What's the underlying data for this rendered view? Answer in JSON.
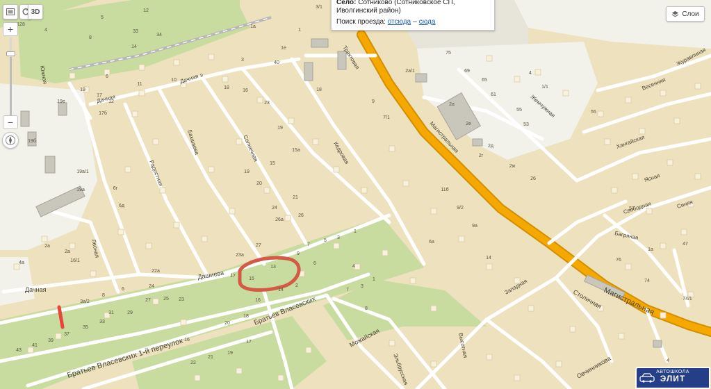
{
  "popup": {
    "title_bold": "Село:",
    "title_text": "Сотниково (Сотниковское СП, Иволгинский район)",
    "route_label": "Поиск проезда:",
    "route_from": "отсюда",
    "route_to": "сюда",
    "route_dash": "–"
  },
  "layers": {
    "label": "Слои",
    "icon": "layers-icon"
  },
  "controls": {
    "fullscreen_icon": "fullscreen-icon",
    "rotate_icon": "rotate-icon",
    "view_3d": "3D",
    "zoom_in": "+",
    "zoom_out": "−",
    "zoom_level": 0.82,
    "compass_icon": "compass-icon"
  },
  "streets": {
    "magistralnaya_1": "Магистральная",
    "magistralnaya_2": "Магистральная",
    "dachnaya_1": "Дачная",
    "dachnaya_2": "Дачная",
    "dachnaya_3": "Дачная",
    "dashieva": "Дашиева",
    "bratyev_vlasevskikh": "Братьев Власевских",
    "pereulok_1": "Братьев Власевских 1-й переулок",
    "mozhayskaya": "Можайская",
    "elbrusskaya": "Эльбрусская",
    "vysotnaya": "Высотная",
    "zapadnaya": "Западная",
    "stolichnaya": "Столичная",
    "ovchinnikova": "Овчинникова",
    "bagryanaya": "Багряная",
    "svobodnaya": "Свободная",
    "sinyaya": "Синяя",
    "yasnaya": "Ясная",
    "traktovaya": "Трактовая",
    "bakshaeva": "Бакшаева",
    "radostnaya": "Радостная",
    "solnechnaya": "Солнечная",
    "kedrovaya": "Кедровая",
    "zhemchuzhnaya": "Жемчужная",
    "khangaiskaya": "Хангайская",
    "vesennyaya": "Весенняя",
    "lesnaya": "Лесная",
    "yuzhnaya": "Южная",
    "zhuravlinaya": "Журавлиная"
  },
  "house_numbers": {
    "h01": "128",
    "h02": "4",
    "h03": "5",
    "h04": "8",
    "h05": "6",
    "h06": "11",
    "h07": "12",
    "h08": "33",
    "h09": "34",
    "h10": "14",
    "h11": "19",
    "h12": "10",
    "h13": "9",
    "h14": "17",
    "h15": "12",
    "h16": "18",
    "h17": "3",
    "h18": "40",
    "h19": "1е",
    "h20": "1a",
    "h21": "1",
    "h22": "3/1",
    "h23": "16",
    "h24": "18",
    "h25": "23",
    "h26": "19",
    "h27": "15",
    "h28": "15а",
    "h29": "19",
    "h30": "20",
    "h31": "21",
    "h32": "24",
    "h33": "26а",
    "h34": "26",
    "h35": "27",
    "h36": "23а",
    "h37": "17",
    "h38": "16",
    "h39": "15",
    "h40": "13",
    "h41": "14",
    "h42": "9",
    "h43": "7",
    "h44": "6",
    "h45": "5",
    "h46": "3",
    "h47": "1",
    "h48": "2",
    "h49": "4",
    "h50": "8",
    "h51": "7",
    "h52": "3",
    "h53": "1",
    "h54": "16",
    "h55": "18",
    "h56": "20",
    "h57": "17",
    "h58": "19",
    "h59": "21",
    "h60": "22",
    "h61": "23",
    "h62": "24",
    "h63": "25",
    "h64": "27",
    "h65": "29",
    "h66": "31",
    "h67": "33",
    "h68": "35",
    "h69": "37",
    "h70": "39",
    "h71": "41",
    "h72": "43",
    "h73": "3а/2",
    "h74": "8",
    "h75": "6",
    "h76": "2а",
    "h77": "4а",
    "h78": "16/1",
    "h79": "2а",
    "h80": "19е",
    "h81": "19б",
    "h82": "19а/1",
    "h83": "19а",
    "h84": "17б",
    "h85": "6г",
    "h86": "6д",
    "h87": "22а",
    "h88": "2а/1",
    "h89": "2а",
    "h90": "2е",
    "h91": "2д",
    "h92": "2г",
    "h93": "2ж",
    "h94": "75",
    "h95": "69",
    "h96": "65",
    "h97": "61",
    "h98": "55",
    "h99": "53",
    "h100": "26",
    "h101": "11б",
    "h102": "9/2",
    "h103": "9а",
    "h104": "6а",
    "h105": "7/1",
    "h106": "9",
    "h107": "14",
    "h108": "4",
    "h109": "1/1",
    "h110": "51",
    "h111": "47",
    "h112": "1а",
    "h113": "74",
    "h114": "74/1",
    "h115": "76",
    "h116": "4",
    "h117": "55"
  },
  "highlight": {
    "color": "#d45a46",
    "marker_color": "#e8453c"
  },
  "badge": {
    "small": "АВТОШКОЛА",
    "big": "ЭЛИТ",
    "icon": "car-icon"
  },
  "colors": {
    "base": "#eee1bd",
    "park": "#c8dca0",
    "highway": "#f5a800",
    "road": "#ffffff",
    "industrial": "#f2f1ea"
  }
}
